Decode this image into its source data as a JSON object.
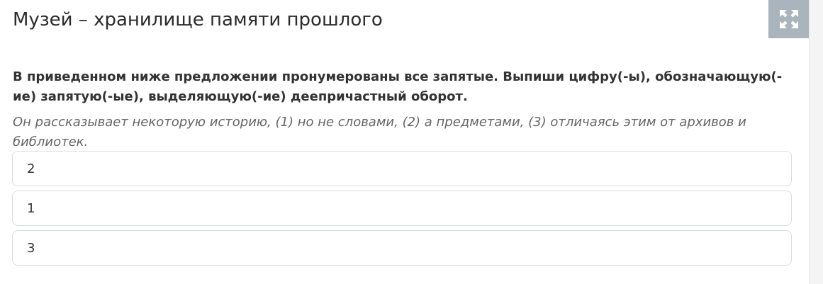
{
  "header": {
    "title": "Музей – хранилище памяти прошлого",
    "expand_icon": "expand-arrows-icon",
    "expand_button_color": "#a9b4bd"
  },
  "question": {
    "instruction": "В приведенном ниже предложении пронумерованы все запятые. Выпиши цифру(-ы), обозначающую(-ие) запятую(-ые), выделяющую(-ие) деепричастный оборот.",
    "sentence": "Он рассказывает некоторую историю, (1) но не словами, (2) а предметами, (3) отличаясь этим от архивов и библиотек."
  },
  "options": [
    {
      "label": "2"
    },
    {
      "label": "1"
    },
    {
      "label": "3"
    }
  ]
}
